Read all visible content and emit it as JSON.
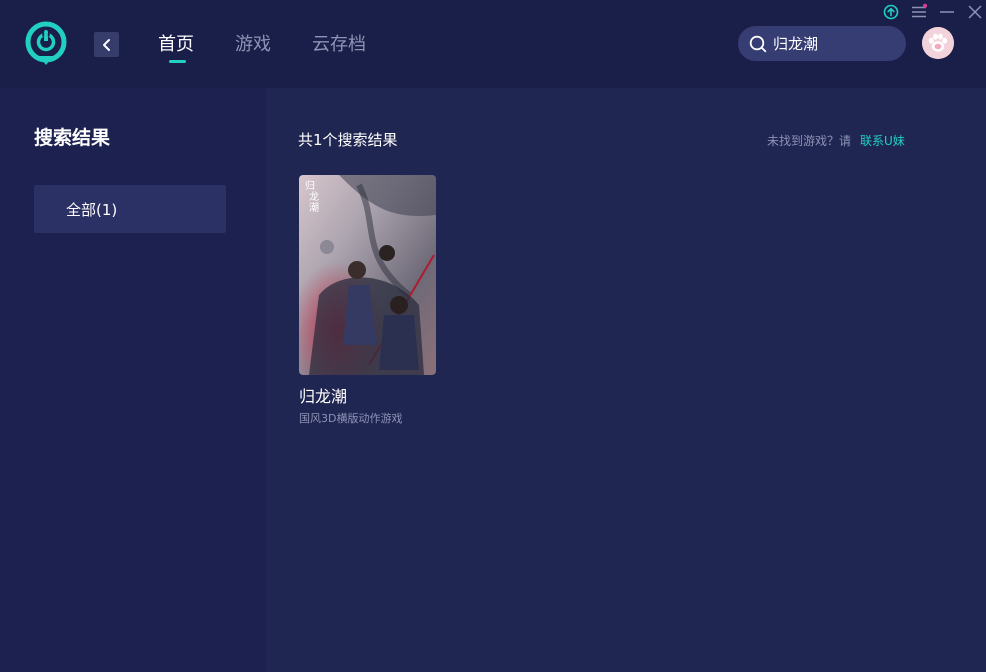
{
  "header": {
    "nav_tabs": [
      {
        "label": "首页",
        "active": true
      },
      {
        "label": "游戏",
        "active": false
      },
      {
        "label": "云存档",
        "active": false
      }
    ],
    "search": {
      "value": "归龙潮"
    },
    "accent_color": "#22cfc3",
    "notification_dot_color": "#e0399a"
  },
  "sidebar": {
    "title": "搜索结果",
    "filters": [
      {
        "label": "全部(1)",
        "selected": true
      }
    ]
  },
  "main": {
    "result_count": "共1个搜索结果",
    "not_found_text": "未找到游戏？请",
    "contact_link": "联系U妹",
    "games": [
      {
        "title": "归龙潮",
        "description": "国风3D横版动作游戏",
        "cover_text": "归龙潮"
      }
    ]
  },
  "icons": {
    "logo": "logo-icon",
    "back": "chevron-left-icon",
    "search": "search-icon",
    "avatar": "paw-avatar",
    "upload": "upload-icon",
    "menu": "menu-icon",
    "minimize": "minimize-icon",
    "close": "close-icon"
  }
}
